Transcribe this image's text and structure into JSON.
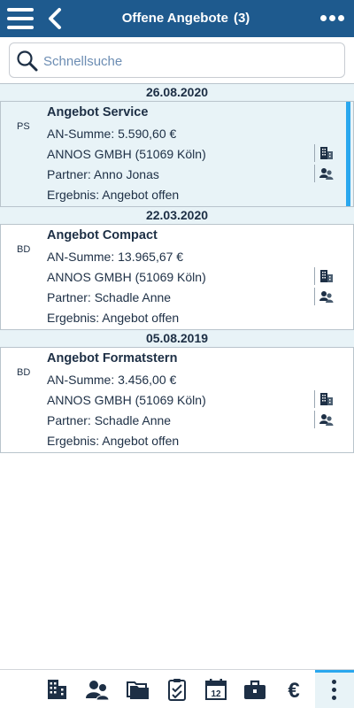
{
  "header": {
    "title": "Offene Angebote",
    "count": "(3)"
  },
  "search": {
    "placeholder": "Schnellsuche",
    "value": ""
  },
  "groups": [
    {
      "date": "26.08.2020",
      "entry": {
        "initials": "PS",
        "title": "Angebot Service",
        "sum": "AN-Summe: 5.590,60 €",
        "company": "ANNOS GMBH (51069 Köln)",
        "partner": "Partner: Anno Jonas",
        "result": "Ergebnis: Angebot offen",
        "selected": true
      }
    },
    {
      "date": "22.03.2020",
      "entry": {
        "initials": "BD",
        "title": "Angebot Compact",
        "sum": "AN-Summe: 13.965,67 €",
        "company": "ANNOS GMBH (51069 Köln)",
        "partner": "Partner: Schadle Anne",
        "result": "Ergebnis: Angebot offen",
        "selected": false
      }
    },
    {
      "date": "05.08.2019",
      "entry": {
        "initials": "BD",
        "title": "Angebot Formatstern",
        "sum": "AN-Summe: 3.456,00 €",
        "company": "ANNOS GMBH (51069 Köln)",
        "partner": "Partner: Schadle Anne",
        "result": "Ergebnis: Angebot offen",
        "selected": false
      }
    }
  ],
  "bottom_nav": {
    "icons": [
      "building-icon",
      "contacts-icon",
      "folders-icon",
      "clipboard-check-icon",
      "calendar-icon",
      "briefcase-icon",
      "euro-icon",
      "more-vertical-icon"
    ],
    "calendar_day": "12",
    "euro_symbol": "€"
  },
  "colors": {
    "header_bg": "#1e5a8e",
    "accent": "#2aa7ee",
    "selected_bg": "#e8f3f7",
    "text": "#1d2f45"
  }
}
